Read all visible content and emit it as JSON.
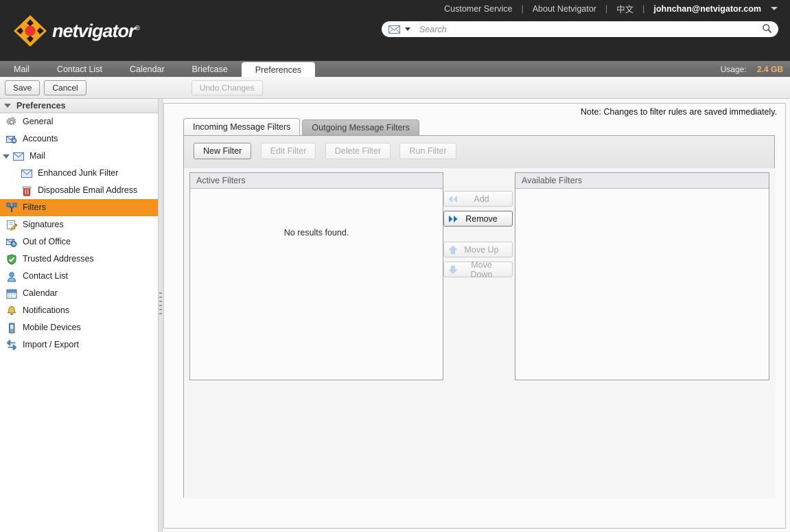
{
  "header": {
    "brand": {
      "name_part1": "net",
      "name_part2": "vigator",
      "registered": "®",
      "logo_icon": "netvigator-diamond-logo"
    },
    "links": [
      {
        "label": "Customer Service"
      },
      {
        "label": "About Netvigator"
      },
      {
        "label": "中文"
      }
    ],
    "separator": "|",
    "user_email": "johnchan@netvigator.com",
    "user_caret_icon": "chevron-down-icon",
    "search": {
      "scope_icon": "envelope-icon",
      "scope_caret_icon": "chevron-down-icon",
      "placeholder": "Search",
      "value": "",
      "submit_icon": "magnifier-icon"
    }
  },
  "appbar": {
    "tabs": [
      {
        "label": "Mail",
        "active": false
      },
      {
        "label": "Contact List",
        "active": false
      },
      {
        "label": "Calendar",
        "active": false
      },
      {
        "label": "Briefcase",
        "active": false
      },
      {
        "label": "Preferences",
        "active": true
      }
    ],
    "usage_label": "Usage:",
    "usage_value": "2.4 GB"
  },
  "toolbar": {
    "save_label": "Save",
    "cancel_label": "Cancel",
    "undo_label": "Undo Changes"
  },
  "sidebar": {
    "header_label": "Preferences",
    "items": [
      {
        "label": "General",
        "icon": "gear-icon",
        "indent": false,
        "selected": false,
        "expander": false
      },
      {
        "label": "Accounts",
        "icon": "accounts-icon",
        "indent": false,
        "selected": false,
        "expander": false
      },
      {
        "label": "Mail",
        "icon": "envelope-icon",
        "indent": false,
        "selected": false,
        "expander": true
      },
      {
        "label": "Enhanced Junk Filter",
        "icon": "envelope-icon",
        "indent": true,
        "selected": false,
        "expander": false
      },
      {
        "label": "Disposable Email Address",
        "icon": "trash-icon",
        "indent": true,
        "selected": false,
        "expander": false
      },
      {
        "label": "Filters",
        "icon": "filters-icon",
        "indent": false,
        "selected": true,
        "expander": false
      },
      {
        "label": "Signatures",
        "icon": "signature-icon",
        "indent": false,
        "selected": false,
        "expander": false
      },
      {
        "label": "Out of Office",
        "icon": "clock-icon",
        "indent": false,
        "selected": false,
        "expander": false
      },
      {
        "label": "Trusted Addresses",
        "icon": "shield-check-icon",
        "indent": false,
        "selected": false,
        "expander": false
      },
      {
        "label": "Contact List",
        "icon": "person-icon",
        "indent": false,
        "selected": false,
        "expander": false
      },
      {
        "label": "Calendar",
        "icon": "calendar-icon",
        "indent": false,
        "selected": false,
        "expander": false
      },
      {
        "label": "Notifications",
        "icon": "bell-icon",
        "indent": false,
        "selected": false,
        "expander": false
      },
      {
        "label": "Mobile Devices",
        "icon": "mobile-phone-icon",
        "indent": false,
        "selected": false,
        "expander": false
      },
      {
        "label": "Import / Export",
        "icon": "import-export-icon",
        "indent": false,
        "selected": false,
        "expander": false
      }
    ]
  },
  "main": {
    "note": "Note: Changes to filter rules are saved immediately.",
    "tabs": [
      {
        "label": "Incoming Message Filters",
        "active": true
      },
      {
        "label": "Outgoing Message Filters",
        "active": false
      }
    ],
    "filter_buttons": [
      {
        "label": "New Filter",
        "enabled": true
      },
      {
        "label": "Edit Filter",
        "enabled": false
      },
      {
        "label": "Delete Filter",
        "enabled": false
      },
      {
        "label": "Run Filter",
        "enabled": false
      }
    ],
    "active_filters": {
      "title": "Active Filters",
      "empty_message": "No results found.",
      "rows": []
    },
    "available_filters": {
      "title": "Available Filters",
      "empty_message": "",
      "rows": []
    },
    "transfer_buttons": [
      {
        "label": "Add",
        "icon": "double-chevron-left-icon",
        "enabled": false
      },
      {
        "label": "Remove",
        "icon": "double-chevron-right-icon",
        "enabled": true
      },
      {
        "label": "Move Up",
        "icon": "arrow-up-icon",
        "enabled": false
      },
      {
        "label": "Move Down",
        "icon": "arrow-down-icon",
        "enabled": false
      }
    ]
  },
  "colors": {
    "header_bg": "#272727",
    "accent_orange": "#f5921e",
    "usage_value": "#f7b267",
    "appbar_bg": "#6e6e6e"
  }
}
